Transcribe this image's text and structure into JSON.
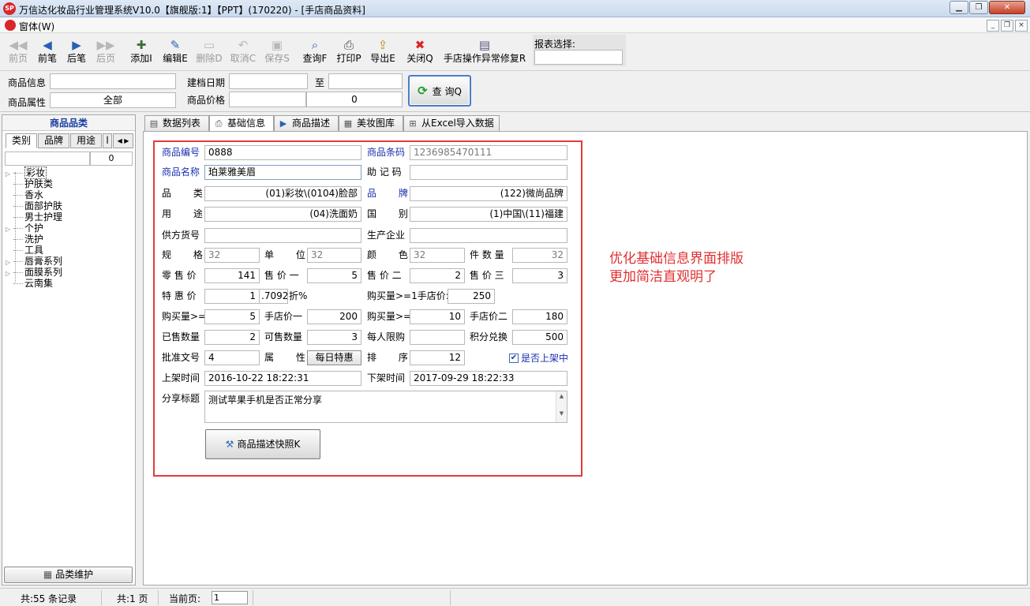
{
  "window": {
    "title": "万信达化妆品行业管理系统V10.0【旗舰版:1】【PPT】(170220) - [手店商品资料]",
    "logo_text": "SP"
  },
  "menu": {
    "window_label": "窗体(W)"
  },
  "toolbar": {
    "buttons": [
      {
        "label": "前页",
        "icon": "first-page-icon",
        "glyph": "◀◀",
        "enabled": false
      },
      {
        "label": "前笔",
        "icon": "previous-icon",
        "glyph": "◀",
        "enabled": true
      },
      {
        "label": "后笔",
        "icon": "next-icon",
        "glyph": "▶",
        "enabled": true
      },
      {
        "label": "后页",
        "icon": "last-page-icon",
        "glyph": "▶▶",
        "enabled": false
      },
      {
        "label": "添加I",
        "icon": "add-icon",
        "glyph": "✚",
        "enabled": true
      },
      {
        "label": "编辑E",
        "icon": "edit-icon",
        "glyph": "✎",
        "enabled": true
      },
      {
        "label": "删除D",
        "icon": "delete-icon",
        "glyph": "▭",
        "enabled": false
      },
      {
        "label": "取消C",
        "icon": "undo-icon",
        "glyph": "↶",
        "enabled": false
      },
      {
        "label": "保存S",
        "icon": "save-icon",
        "glyph": "▣",
        "enabled": false
      },
      {
        "label": "查询F",
        "icon": "query-icon",
        "glyph": "⌕",
        "enabled": true
      },
      {
        "label": "打印P",
        "icon": "print-icon",
        "glyph": "⎙",
        "enabled": true
      },
      {
        "label": "导出E",
        "icon": "export-icon",
        "glyph": "⇪",
        "enabled": true
      },
      {
        "label": "关闭Q",
        "icon": "close-icon",
        "glyph": "✖",
        "enabled": true
      },
      {
        "label": "手店操作异常修复R",
        "icon": "repair-icon",
        "glyph": "▤",
        "enabled": true
      }
    ],
    "report_label": "报表选择:",
    "report_value": ""
  },
  "filter": {
    "product_info_label": "商品信息",
    "product_info_value": "",
    "product_attr_label": "商品属性",
    "product_attr_value": "全部",
    "date_label": "建档日期",
    "date_from": "",
    "to_label": "至",
    "date_to": "",
    "price_label": "商品价格",
    "price_from": "",
    "price_to": "0",
    "query_button": "查 询Q"
  },
  "left_panel": {
    "header": "商品品类",
    "tabs": [
      "类别",
      "品牌",
      "用途",
      "l"
    ],
    "search_value": "",
    "count": "0",
    "tree": [
      {
        "label": "彩妆",
        "expandable": true,
        "selected": true
      },
      {
        "label": "护肤类",
        "expandable": false
      },
      {
        "label": "香水",
        "expandable": false
      },
      {
        "label": "面部护肤",
        "expandable": false
      },
      {
        "label": "男士护理",
        "expandable": false
      },
      {
        "label": "个护",
        "expandable": true
      },
      {
        "label": "洗护",
        "expandable": false
      },
      {
        "label": "工具",
        "expandable": false
      },
      {
        "label": "唇膏系列",
        "expandable": true
      },
      {
        "label": "面膜系列",
        "expandable": true
      },
      {
        "label": "云南集",
        "expandable": false
      }
    ],
    "maintain_button": "品类维护"
  },
  "tabs": [
    {
      "label": "数据列表",
      "icon": "list-icon"
    },
    {
      "label": "基础信息",
      "icon": "printer-tab-icon"
    },
    {
      "label": "商品描述",
      "icon": "play-icon"
    },
    {
      "label": "美妆图库",
      "icon": "gallery-icon"
    },
    {
      "label": "从Excel导入数据",
      "icon": "excel-icon"
    }
  ],
  "form": {
    "code_label": "商品编号",
    "code": "0888",
    "barcode_label": "商品条码",
    "barcode": "1236985470111",
    "name_label": "商品名称",
    "name": "珀莱雅美眉",
    "mnemonic_label": "助 记 码",
    "mnemonic": "",
    "category_label": "品 类",
    "category": "(01)彩妆\\(0104)脸部",
    "brand_label": "品 牌",
    "brand": "(122)微尚品牌",
    "usage_label": "用 途",
    "usage": "(04)洗面奶",
    "country_label": "国 别",
    "country": "(1)中国\\(11)福建",
    "supplier_no_label": "供方货号",
    "supplier_no": "",
    "manufacturer_label": "生产企业",
    "manufacturer": "",
    "spec_label": "规 格",
    "spec": "32",
    "unit_label": "单 位",
    "unit": "32",
    "color_label": "颜 色",
    "color": "32",
    "pieces_label": "件 数 量",
    "pieces": "32",
    "retail_label": "零 售 价",
    "retail": "141",
    "price1_label": "售 价 一",
    "price1": "5",
    "price2_label": "售 价 二",
    "price2": "2",
    "price3_label": "售 价 三",
    "price3": "3",
    "special_label": "特 惠 价",
    "special": "1",
    "discount": ".7092",
    "discount_label": "折%",
    "buy_ge1_label": "购买量>=1手店价:",
    "buy_ge1_price": "250",
    "buy_qty1_label": "购买量>=",
    "buy_qty1": "5",
    "shop_price1_label": "手店价一",
    "shop_price1": "200",
    "buy_qty2_label": "购买量>=",
    "buy_qty2": "10",
    "shop_price2_label": "手店价二",
    "shop_price2": "180",
    "sold_label": "已售数量",
    "sold": "2",
    "available_label": "可售数量",
    "available": "3",
    "limit_label": "每人限购",
    "limit": "",
    "points_label": "积分兑换",
    "points": "500",
    "approval_label": "批准文号",
    "approval": "4",
    "attribute_label": "属 性",
    "attribute": "每日特惠",
    "sort_label": "排 序",
    "sort": "12",
    "on_shelf_label": "是否上架中",
    "on_shelf_checked": "✔",
    "shelf_on_label": "上架时间",
    "shelf_on": "2016-10-22 18:22:31",
    "shelf_off_label": "下架时间",
    "shelf_off": "2017-09-29 18:22:33",
    "share_label": "分享标题",
    "share_title": "测试苹果手机是否正常分享",
    "snapshot_button": "商品描述快照K"
  },
  "annotation": {
    "line1": "优化基础信息界面排版",
    "line2": "更加简洁直观明了"
  },
  "status": {
    "records": "共:55 条记录",
    "pages": "共:1 页",
    "current_label": "当前页:",
    "current_page": "1"
  },
  "colors": {
    "highlight_border": "#e33b3b",
    "label_blue": "#1a2fb0",
    "annotation": "#e03030"
  }
}
